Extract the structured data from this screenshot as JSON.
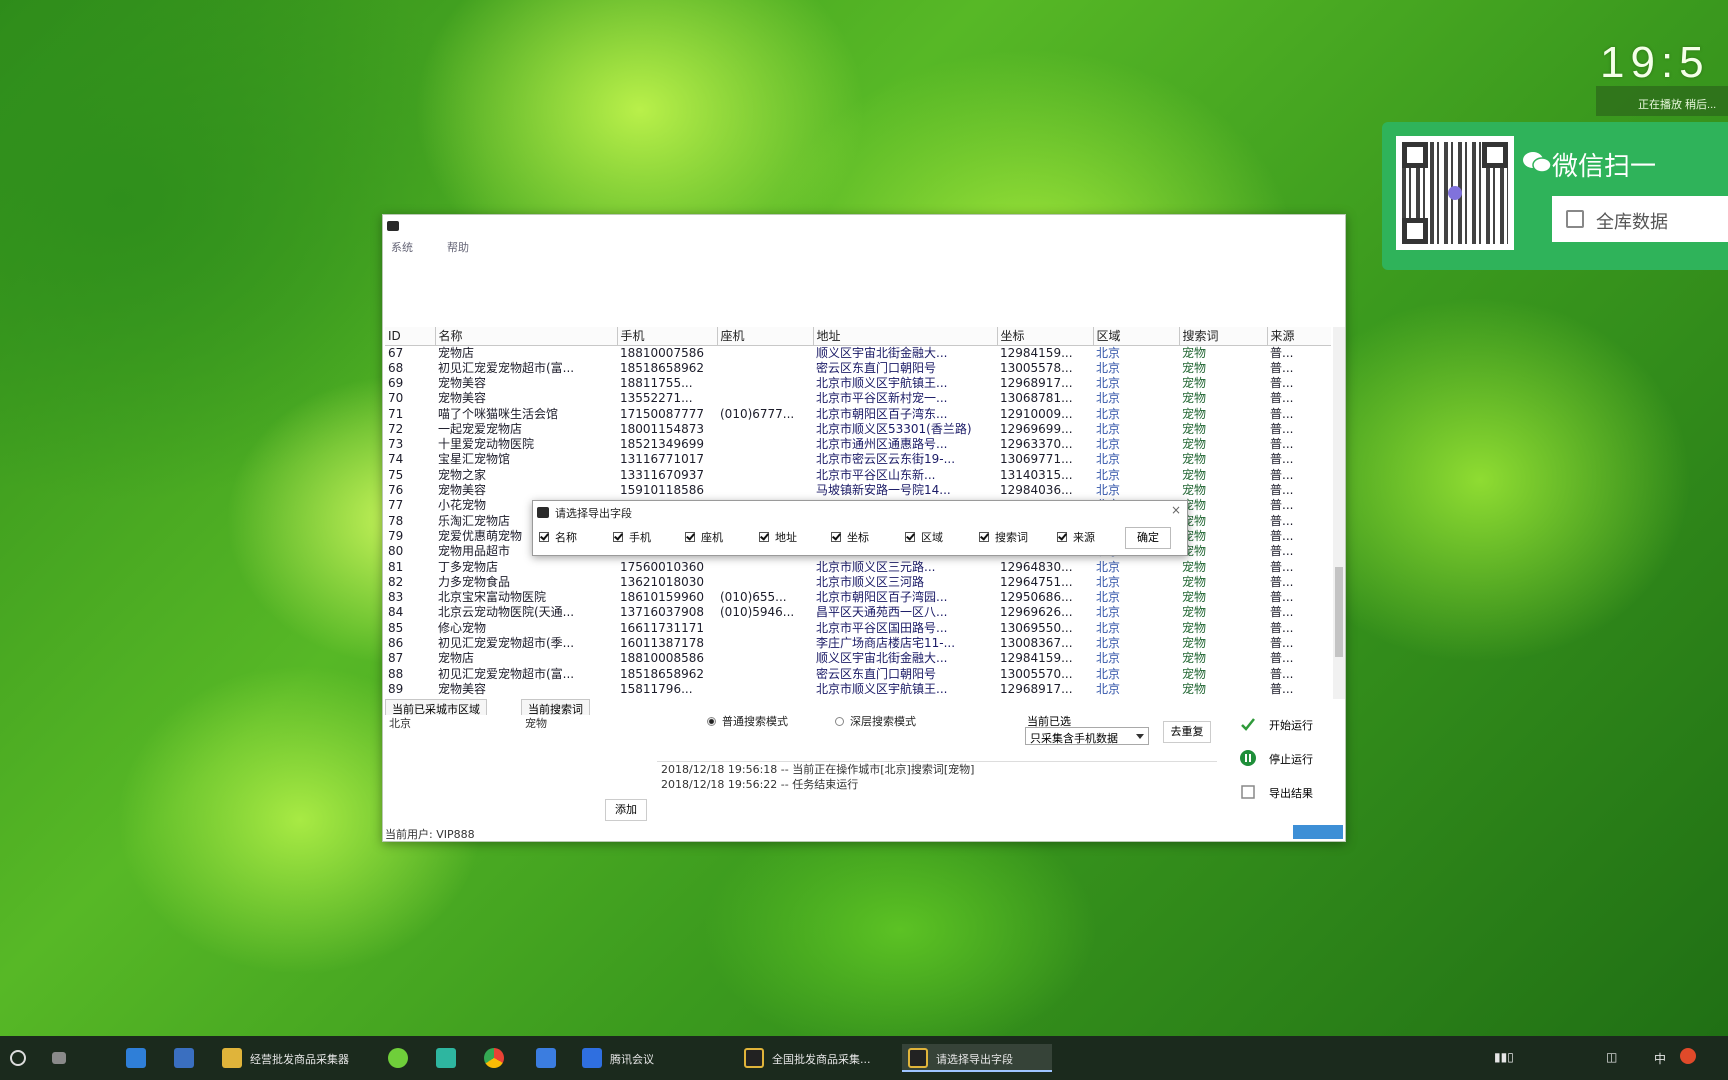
{
  "desktop": {
    "clock": "19:5",
    "clock_sub": "正在播放 稍后..."
  },
  "wechat_widget": {
    "title": "微信扫一",
    "box_text": "全库数据"
  },
  "app": {
    "title": "",
    "menu": [
      "系统",
      "帮助"
    ],
    "columns": [
      "ID",
      "名称",
      "手机",
      "座机",
      "地址",
      "坐标",
      "区域",
      "搜索词",
      "来源"
    ],
    "rows": [
      [
        "67",
        "宠物店",
        "18810007586",
        "",
        "顺义区宇宙北街金融大...",
        "12984159...",
        "北京",
        "宠物",
        "普..."
      ],
      [
        "68",
        "初见汇宠爱宠物超市(富...",
        "18518658962",
        "",
        "密云区东直门口朝阳号",
        "13005578...",
        "北京",
        "宠物",
        "普..."
      ],
      [
        "69",
        "宠物美容",
        "18811755...",
        "",
        "北京市顺义区宇航镇王...",
        "12968917...",
        "北京",
        "宠物",
        "普..."
      ],
      [
        "70",
        "宠物美容",
        "13552271...",
        "",
        "北京市平谷区新村宠一...",
        "13068781...",
        "北京",
        "宠物",
        "普..."
      ],
      [
        "71",
        "喵了个咪猫咪生活会馆",
        "17150087777",
        "(010)6777...",
        "北京市朝阳区百子湾东...",
        "12910009...",
        "北京",
        "宠物",
        "普..."
      ],
      [
        "72",
        "一起宠爱宠物店",
        "18001154873",
        "",
        "北京市顺义区53301(香兰路)",
        "12969699...",
        "北京",
        "宠物",
        "普..."
      ],
      [
        "73",
        "十里爱宠动物医院",
        "18521349699",
        "",
        "北京市通州区通惠路号...",
        "12963370...",
        "北京",
        "宠物",
        "普..."
      ],
      [
        "74",
        "宝星汇宠物馆",
        "13116771017",
        "",
        "北京市密云区云东街19-...",
        "13069771...",
        "北京",
        "宠物",
        "普..."
      ],
      [
        "75",
        "宠物之家",
        "13311670937",
        "",
        "北京市平谷区山东新...",
        "13140315...",
        "北京",
        "宠物",
        "普..."
      ],
      [
        "76",
        "宠物美容",
        "15910118586",
        "",
        "马坡镇新安路一号院14...",
        "12984036...",
        "北京",
        "宠物",
        "普..."
      ],
      [
        "77",
        "小花宠物",
        "",
        "",
        "",
        "",
        "北京",
        "宠物",
        "普..."
      ],
      [
        "78",
        "乐淘汇宠物店",
        "",
        "",
        "",
        "",
        "北京",
        "宠物",
        "普..."
      ],
      [
        "79",
        "宠爱优惠萌宠物",
        "",
        "",
        "",
        "",
        "北京",
        "宠物",
        "普..."
      ],
      [
        "80",
        "宠物用品超市",
        "",
        "",
        "",
        "",
        "北京",
        "宠物",
        "普..."
      ],
      [
        "81",
        "丁多宠物店",
        "17560010360",
        "",
        "北京市顺义区三元路...",
        "12964830...",
        "北京",
        "宠物",
        "普..."
      ],
      [
        "82",
        "力多宠物食品",
        "13621018030",
        "",
        "北京市顺义区三河路",
        "12964751...",
        "北京",
        "宠物",
        "普..."
      ],
      [
        "83",
        "北京宝宋富动物医院",
        "18610159960",
        "(010)655...",
        "北京市朝阳区百子湾园...",
        "12950686...",
        "北京",
        "宠物",
        "普..."
      ],
      [
        "84",
        "北京云宠动物医院(天通...",
        "13716037908",
        "(010)5946...",
        "昌平区天通苑西一区八...",
        "12969626...",
        "北京",
        "宠物",
        "普..."
      ],
      [
        "85",
        "修心宠物",
        "16611731171",
        "",
        "北京市平谷区国田路号...",
        "13069550...",
        "北京",
        "宠物",
        "普..."
      ],
      [
        "86",
        "初见汇宠爱宠物超市(季...",
        "16011387178",
        "",
        "李庄广场商店楼店宅11-...",
        "13008367...",
        "北京",
        "宠物",
        "普..."
      ],
      [
        "87",
        "宠物店",
        "18810008586",
        "",
        "顺义区宇宙北街金融大...",
        "12984159...",
        "北京",
        "宠物",
        "普..."
      ],
      [
        "88",
        "初见汇宠爱宠物超市(富...",
        "18518658962",
        "",
        "密云区东直门口朝阳号",
        "13005570...",
        "北京",
        "宠物",
        "普..."
      ],
      [
        "89",
        "宠物美容",
        "15811796...",
        "",
        "北京市顺义区宇航镇王...",
        "12968917...",
        "北京",
        "宠物",
        "普..."
      ]
    ],
    "tabs": [
      "当前已采城市区域",
      "当前搜索词"
    ],
    "tab_values": [
      "北京",
      "宠物"
    ],
    "radio_normal": "普通搜索模式",
    "radio_deep": "深层搜索模式",
    "select_label": "当前已选",
    "select_value": "只采集含手机数据",
    "dedupe_button": "去重复",
    "log_lines": [
      "2018/12/18 19:56:18 -- 当前正在操作城市[北京]搜索词[宠物]",
      "2018/12/18 19:56:22 -- 任务结束运行"
    ],
    "add_button": "添加",
    "start_button": "开始运行",
    "stop_button": "停止运行",
    "export_button": "导出结果",
    "status_user": "当前用户: VIP888"
  },
  "dialog": {
    "title": "请选择导出字段",
    "fields": [
      "名称",
      "手机",
      "座机",
      "地址",
      "坐标",
      "区域",
      "搜索词",
      "来源"
    ],
    "ok_label": "确定"
  },
  "taskbar": {
    "items": [
      {
        "label": ""
      },
      {
        "label": ""
      },
      {
        "label": ""
      },
      {
        "label": "经营批发商品采集器"
      },
      {
        "label": ""
      },
      {
        "label": ""
      },
      {
        "label": ""
      },
      {
        "label": ""
      },
      {
        "label": "腾讯会议"
      },
      {
        "label": "全国批发商品采集..."
      },
      {
        "label": "请选择导出字段"
      }
    ],
    "tray_lang": "中"
  }
}
